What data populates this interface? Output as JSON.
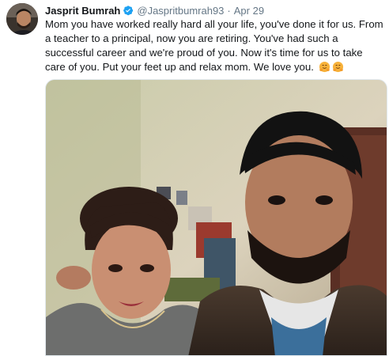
{
  "tweet": {
    "author_name": "Jasprit Bumrah",
    "handle": "@Jaspritbumrah93",
    "separator": "·",
    "date": "Apr 29",
    "text": "Mom you have worked really hard all your life, you've done it for us. From a teacher to a principal, now you are retiring. You've had such a successful career and we're proud of you. Now it's time for us to take care of you. Put your feet up and relax mom. We love you.",
    "emoji_count": 2
  },
  "icons": {
    "verified": "verified-badge-icon",
    "emoji": "hugging-face-emoji"
  },
  "colors": {
    "verified_blue": "#1da1f2",
    "muted_text": "#657786",
    "emoji_yellow": "#f7b23b"
  }
}
